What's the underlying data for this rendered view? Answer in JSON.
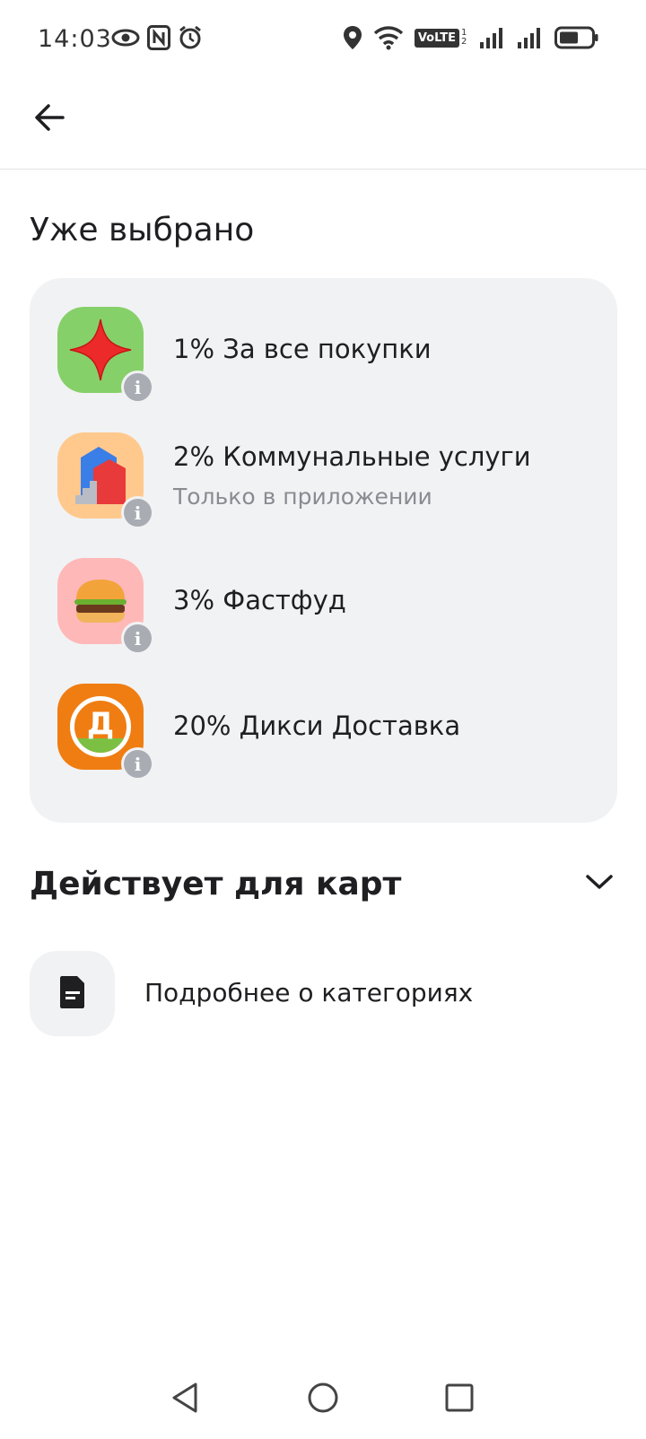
{
  "status_bar": {
    "time": "14:03",
    "left_icons": [
      "eye-icon",
      "nfc-icon",
      "alarm-icon"
    ],
    "right_icons": [
      "location-icon",
      "wifi-icon",
      "volte-icon",
      "signal-1-icon",
      "signal-2-icon",
      "battery-icon"
    ],
    "volte_text": "VoLTE",
    "volte_sub": "1 2"
  },
  "header": {
    "back_icon": "arrow-left-icon"
  },
  "selected": {
    "title": "Уже выбрано",
    "items": [
      {
        "label": "1% За все покупки",
        "sublabel": "",
        "icon": "red-star-icon",
        "tile_color": "#86d06a"
      },
      {
        "label": "2% Коммунальные услуги",
        "sublabel": "Только в приложении",
        "icon": "house-icon",
        "tile_color": "#ffc98e"
      },
      {
        "label": "3% Фастфуд",
        "sublabel": "",
        "icon": "burger-icon",
        "tile_color": "#ffb8b8"
      },
      {
        "label": "20% Дикси Доставка",
        "sublabel": "",
        "icon": "dixy-logo-icon",
        "tile_color": "#f07d12"
      }
    ],
    "dixy_letter": "Д"
  },
  "cards_section": {
    "title": "Действует для карт",
    "chevron_icon": "chevron-down-icon"
  },
  "details_link": {
    "label": "Подробнее о категориях",
    "icon": "document-icon"
  },
  "colors": {
    "card_bg": "#f1f2f4",
    "text": "#1f1f22",
    "secondary_text": "#8a8b91",
    "info_badge": "#a9acb3"
  },
  "nav_bar": {
    "icons": [
      "back-triangle-icon",
      "home-circle-icon",
      "recents-square-icon"
    ]
  }
}
